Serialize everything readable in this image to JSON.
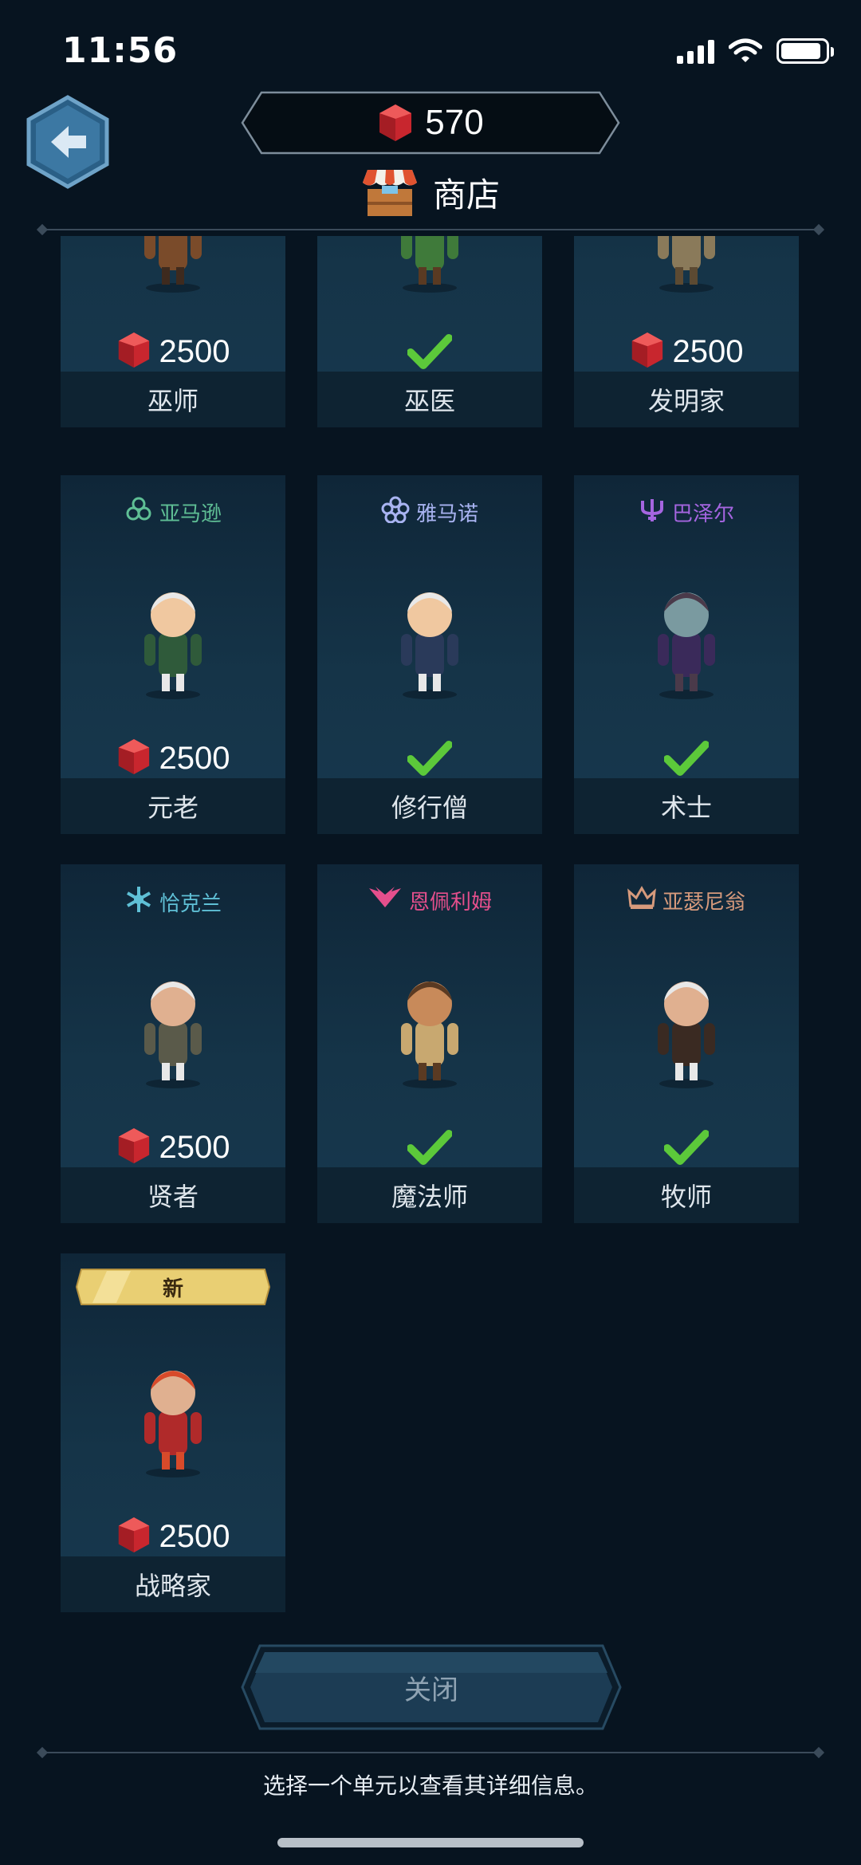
{
  "status": {
    "time": "11:56",
    "battery_level": 0.9
  },
  "header": {
    "gems": "570",
    "title": "商店"
  },
  "colors": {
    "gem": "#c8262e",
    "check": "#5cc93a",
    "accent": "#4c8db8"
  },
  "cards": [
    {
      "name": "巫师",
      "price": "2500",
      "owned": false,
      "faction": "",
      "faction_color": "",
      "new": false
    },
    {
      "name": "巫医",
      "price": "",
      "owned": true,
      "faction": "",
      "faction_color": "",
      "new": false
    },
    {
      "name": "发明家",
      "price": "2500",
      "owned": false,
      "faction": "",
      "faction_color": "",
      "new": false
    },
    {
      "name": "元老",
      "price": "2500",
      "owned": false,
      "faction": "亚马逊",
      "faction_color": "#5fbf95",
      "faction_icon": "triskelion-icon",
      "new": false
    },
    {
      "name": "修行僧",
      "price": "",
      "owned": true,
      "faction": "雅马诺",
      "faction_color": "#a9b4f2",
      "faction_icon": "flower-icon",
      "new": false
    },
    {
      "name": "术士",
      "price": "",
      "owned": true,
      "faction": "巴泽尔",
      "faction_color": "#a565e0",
      "faction_icon": "trident-icon",
      "new": false
    },
    {
      "name": "贤者",
      "price": "2500",
      "owned": false,
      "faction": "恰克兰",
      "faction_color": "#5fc0d6",
      "faction_icon": "snowflake-icon",
      "new": false
    },
    {
      "name": "魔法师",
      "price": "",
      "owned": true,
      "faction": "恩佩利姆",
      "faction_color": "#e54f8c",
      "faction_icon": "wings-icon",
      "new": false
    },
    {
      "name": "牧师",
      "price": "",
      "owned": true,
      "faction": "亚瑟尼翁",
      "faction_color": "#d69a7c",
      "faction_icon": "crown-icon",
      "new": false
    },
    {
      "name": "战略家",
      "price": "2500",
      "owned": false,
      "faction": "",
      "faction_color": "",
      "new": true,
      "new_label": "新"
    }
  ],
  "close_label": "关闭",
  "hint": "选择一个单元以查看其详细信息。"
}
